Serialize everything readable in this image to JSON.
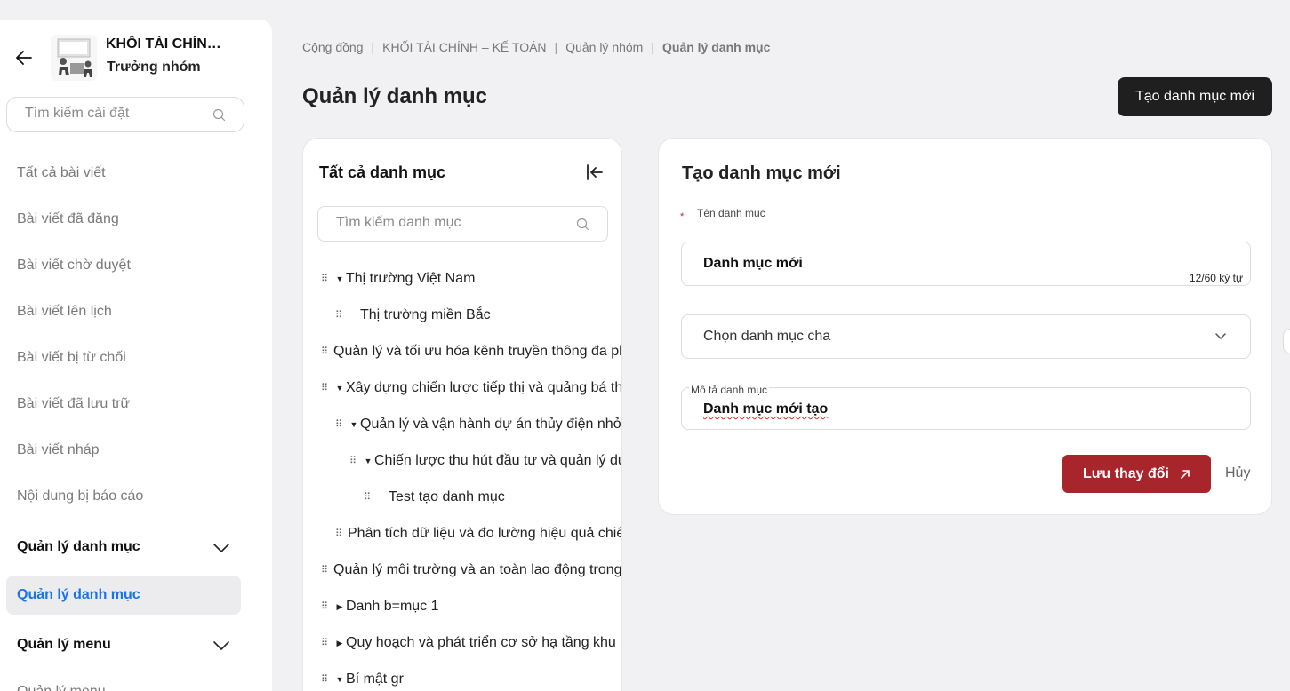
{
  "sidebar": {
    "org_name": "KHỐI TÀI CHÍNH – KẾ TOÁN",
    "org_role": "Trưởng nhóm",
    "search_placeholder": "Tìm kiếm cài đặt",
    "items": [
      {
        "label": "Tất cả bài viết"
      },
      {
        "label": "Bài viết đã đăng"
      },
      {
        "label": "Bài viết chờ duyệt"
      },
      {
        "label": "Bài viết lên lịch"
      },
      {
        "label": "Bài viết bị từ chối"
      },
      {
        "label": "Bài viết đã lưu trữ"
      },
      {
        "label": "Bài viết nháp"
      },
      {
        "label": "Nội dung bị báo cáo"
      }
    ],
    "group_category": "Quản lý danh mục",
    "active_item": "Quản lý danh mục",
    "group_menu": "Quản lý menu",
    "menu_sub": "Quản lý menu"
  },
  "breadcrumb": {
    "community": "Cộng đồng",
    "org": "KHỐI TÀI CHÍNH – KẾ TOÁN",
    "group": "Quản lý nhóm",
    "current": "Quản lý danh mục"
  },
  "page": {
    "title": "Quản lý danh mục",
    "new_button": "Tạo danh mục mới"
  },
  "category_panel": {
    "title": "Tất cả danh mục",
    "search_placeholder": "Tìm kiếm danh mục",
    "tree": [
      {
        "label": "Thị trường Việt Nam",
        "caret": "▼"
      },
      {
        "label": "Thị trường miền Bắc",
        "caret": ""
      },
      {
        "label": "Quản lý và tối ưu hóa kênh truyền thông đa phương tiện",
        "caret": ""
      },
      {
        "label": "Xây dựng chiến lược tiếp thị và quảng bá thương hiệu",
        "caret": "▼"
      },
      {
        "label": "Quản lý và vận hành dự án thủy điện nhỏ",
        "caret": "▼"
      },
      {
        "label": "Chiến lược thu hút đầu tư và quản lý dự án",
        "caret": "▼"
      },
      {
        "label": "Test tạo danh mục",
        "caret": ""
      },
      {
        "label": "Phân tích dữ liệu và đo lường hiệu quả chiến dịch",
        "caret": ""
      },
      {
        "label": "Quản lý môi trường và an toàn lao động trong doanh nghiệp",
        "caret": ""
      },
      {
        "label": "Danh b=mục 1",
        "caret": "▶"
      },
      {
        "label": "Quy hoạch và phát triển cơ sở hạ tầng khu công nghiệp",
        "caret": "▶"
      },
      {
        "label": "Bí mật gr",
        "caret": "▼"
      }
    ]
  },
  "create_panel": {
    "title": "Tạo danh mục mới",
    "required_mark": "*",
    "name_label": "Tên danh mục",
    "name_value": "Danh mục mới",
    "name_counter": "12/60 ký tự",
    "parent_placeholder": "Chọn danh mục cha",
    "desc_label": "Mô tả danh mục",
    "desc_value": "Danh mục mới tạo",
    "save_button": "Lưu thay đổi",
    "cancel_button": "Hủy"
  }
}
